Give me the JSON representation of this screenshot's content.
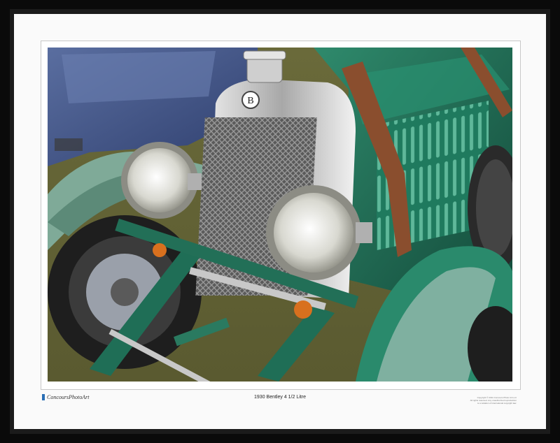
{
  "print": {
    "brand": "ConcoursPhotoArt",
    "caption": "1930 Bentley 4 1/2 Litre",
    "copyright_lines": [
      "Copyright © 2011 Concours Photo Art LLC",
      "All rights reserved. Any unauthorized reproduction",
      "is a violation of international copyright law."
    ]
  },
  "colors": {
    "frame": "#0a0a0a",
    "mat": "#fafafa",
    "brand_mark": "#2a6fb5",
    "car_green": "#1e6b54",
    "fender_green": "#6f9e8c",
    "blue_car": "#4a5c8c"
  }
}
